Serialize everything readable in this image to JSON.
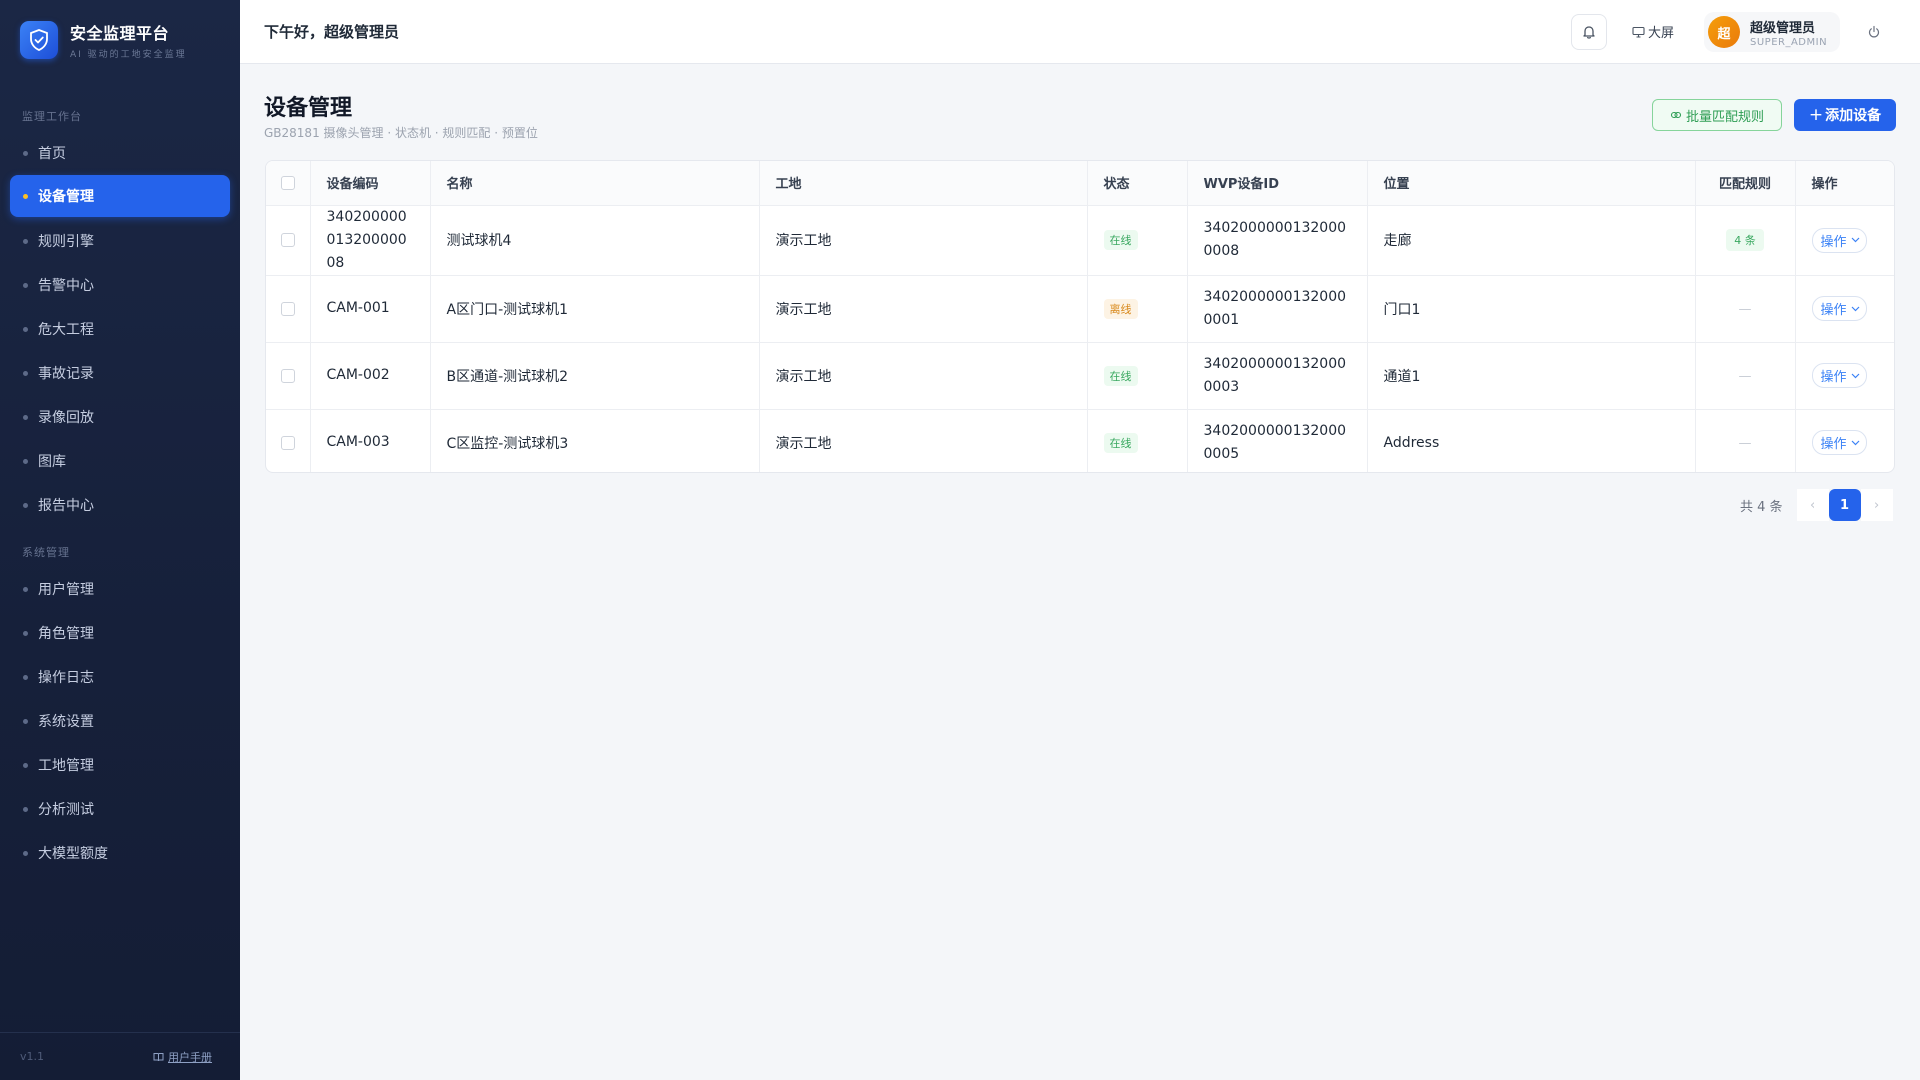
{
  "brand": {
    "title": "安全监理平台",
    "subtitle": "AI 驱动的工地安全监理"
  },
  "sidebar": {
    "section1": "监理工作台",
    "items1": [
      {
        "label": "首页"
      },
      {
        "label": "设备管理",
        "active": true
      },
      {
        "label": "规则引擎"
      },
      {
        "label": "告警中心"
      },
      {
        "label": "危大工程"
      },
      {
        "label": "事故记录"
      },
      {
        "label": "录像回放"
      },
      {
        "label": "图库"
      },
      {
        "label": "报告中心"
      }
    ],
    "section2": "系统管理",
    "items2": [
      {
        "label": "用户管理"
      },
      {
        "label": "角色管理"
      },
      {
        "label": "操作日志"
      },
      {
        "label": "系统设置"
      },
      {
        "label": "工地管理"
      },
      {
        "label": "分析测试"
      },
      {
        "label": "大模型额度"
      }
    ],
    "version": "v1.1",
    "manual": "用户手册"
  },
  "header": {
    "greeting": "下午好，超级管理员",
    "bigscreen": "大屏",
    "avatar": "超",
    "user_name": "超级管理员",
    "user_role": "SUPER_ADMIN"
  },
  "page": {
    "title": "设备管理",
    "subtitle": "GB28181 摄像头管理 · 状态机 · 规则匹配 · 预置位",
    "batch_button": "批量匹配规则",
    "add_button": "添加设备"
  },
  "table": {
    "columns": [
      "设备编码",
      "名称",
      "工地",
      "状态",
      "WVP设备ID",
      "位置",
      "匹配规则",
      "操作"
    ],
    "rows": [
      {
        "code": "34020000001320000008",
        "name": "测试球机4",
        "site": "演示工地",
        "status": "在线",
        "status_type": "online",
        "wvp": "34020000001320000008",
        "location": "走廊",
        "rule": "4 条",
        "action": "操作"
      },
      {
        "code": "CAM-001",
        "name": "A区门口-测试球机1",
        "site": "演示工地",
        "status": "离线",
        "status_type": "offline",
        "wvp": "34020000001320000001",
        "location": "门口1",
        "rule": "—",
        "action": "操作"
      },
      {
        "code": "CAM-002",
        "name": "B区通道-测试球机2",
        "site": "演示工地",
        "status": "在线",
        "status_type": "online",
        "wvp": "34020000001320000003",
        "location": "通道1",
        "rule": "—",
        "action": "操作"
      },
      {
        "code": "CAM-003",
        "name": "C区监控-测试球机3",
        "site": "演示工地",
        "status": "在线",
        "status_type": "online",
        "wvp": "34020000001320000005",
        "location": "Address",
        "rule": "—",
        "action": "操作"
      }
    ]
  },
  "pagination": {
    "total": "共 4 条",
    "current": "1",
    "prev": "‹",
    "next": "›"
  }
}
